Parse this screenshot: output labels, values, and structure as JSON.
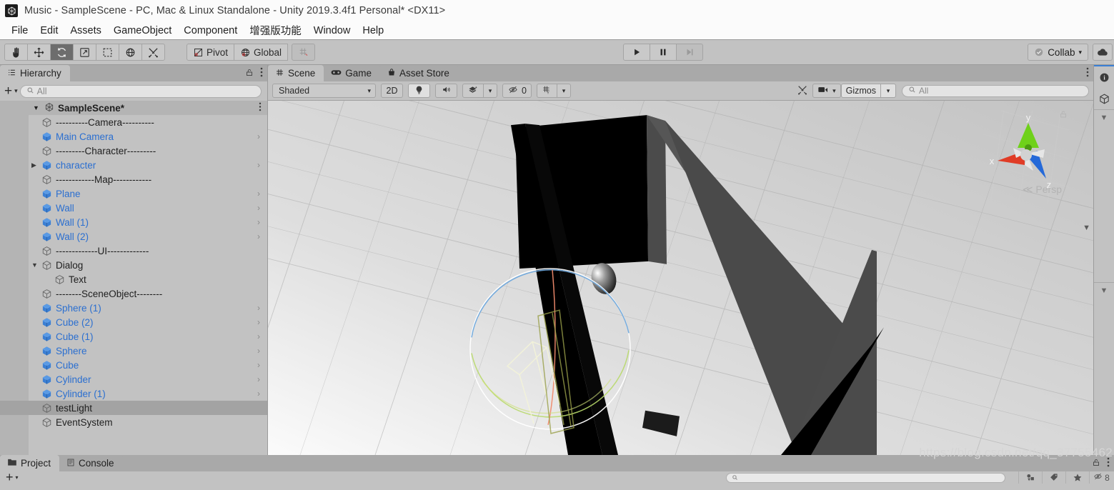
{
  "window": {
    "title": "Music - SampleScene - PC, Mac & Linux Standalone - Unity 2019.3.4f1 Personal* <DX11>",
    "logo_icon": "unity-logo-icon"
  },
  "menubar": {
    "items": [
      {
        "label": "File"
      },
      {
        "label": "Edit"
      },
      {
        "label": "Assets"
      },
      {
        "label": "GameObject"
      },
      {
        "label": "Component"
      },
      {
        "label": "增强版功能"
      },
      {
        "label": "Window"
      },
      {
        "label": "Help"
      }
    ]
  },
  "toolbar": {
    "tools": [
      {
        "name": "hand-tool",
        "icon": "hand-icon",
        "active": false
      },
      {
        "name": "move-tool",
        "icon": "move-arrows-icon",
        "active": false
      },
      {
        "name": "rotate-tool",
        "icon": "rotate-icon",
        "active": true
      },
      {
        "name": "scale-tool",
        "icon": "scale-icon",
        "active": false
      },
      {
        "name": "rect-tool",
        "icon": "rect-transform-icon",
        "active": false
      },
      {
        "name": "transform-tool",
        "icon": "transform-icon",
        "active": false
      },
      {
        "name": "custom-tool",
        "icon": "wrench-hammer-icon",
        "active": false
      }
    ],
    "pivot_label": "Pivot",
    "pivot_icon": "pivot-icon",
    "global_label": "Global",
    "global_icon": "globe-icon",
    "snap_icon": "grid-snap-icon",
    "play_label": "play-icon",
    "pause_label": "pause-icon",
    "step_label": "step-icon",
    "collab_label": "Collab",
    "collab_icon": "cloud-check-icon",
    "collab_caret": "▾",
    "cloud_icon": "cloud-icon"
  },
  "hierarchy": {
    "tabs": [
      {
        "label": "Hierarchy",
        "icon": "hierarchy-icon",
        "active": true
      }
    ],
    "lock_icon": "lock-open-icon",
    "kebab_icon": "kebab-menu-icon",
    "add_label": "+",
    "add_caret": "▾",
    "search": {
      "placeholder": "All",
      "value": "",
      "icon": "search-icon"
    },
    "scene_root": {
      "label": "SampleScene*",
      "icon": "unity-scene-icon",
      "expanded": true
    },
    "items": [
      {
        "label": "----------Camera----------",
        "kind": "separator",
        "icon": "cube-outline-icon",
        "selected": false,
        "expandable": false,
        "arrow": false
      },
      {
        "label": "Main Camera",
        "kind": "prefab",
        "icon": "cube-blue-icon",
        "selected": false,
        "expandable": false,
        "arrow": true
      },
      {
        "label": "---------Character---------",
        "kind": "separator",
        "icon": "cube-outline-icon",
        "selected": false,
        "expandable": false,
        "arrow": false
      },
      {
        "label": "character",
        "kind": "prefab",
        "icon": "cube-blue-icon",
        "selected": false,
        "expandable": true,
        "arrow": true
      },
      {
        "label": "------------Map------------",
        "kind": "separator",
        "icon": "cube-outline-icon",
        "selected": false,
        "expandable": false,
        "arrow": false
      },
      {
        "label": "Plane",
        "kind": "prefab",
        "icon": "cube-blue-icon",
        "selected": false,
        "expandable": false,
        "arrow": true
      },
      {
        "label": "Wall",
        "kind": "prefab",
        "icon": "cube-blue-icon",
        "selected": false,
        "expandable": false,
        "arrow": true
      },
      {
        "label": "Wall (1)",
        "kind": "prefab",
        "icon": "cube-blue-icon",
        "selected": false,
        "expandable": false,
        "arrow": true
      },
      {
        "label": "Wall (2)",
        "kind": "prefab",
        "icon": "cube-blue-icon",
        "selected": false,
        "expandable": false,
        "arrow": true
      },
      {
        "label": "-------------UI-------------",
        "kind": "separator",
        "icon": "cube-outline-icon",
        "selected": false,
        "expandable": false,
        "arrow": false
      },
      {
        "label": "Dialog",
        "kind": "object",
        "icon": "cube-outline-icon",
        "selected": false,
        "expandable": true,
        "expanded": true,
        "arrow": false
      },
      {
        "label": "Text",
        "kind": "object",
        "icon": "cube-outline-icon",
        "selected": false,
        "expandable": false,
        "arrow": false,
        "indent": 2
      },
      {
        "label": "--------SceneObject--------",
        "kind": "separator",
        "icon": "cube-outline-icon",
        "selected": false,
        "expandable": false,
        "arrow": false
      },
      {
        "label": "Sphere (1)",
        "kind": "prefab",
        "icon": "cube-blue-icon",
        "selected": false,
        "expandable": false,
        "arrow": true
      },
      {
        "label": "Cube (2)",
        "kind": "prefab",
        "icon": "cube-blue-icon",
        "selected": false,
        "expandable": false,
        "arrow": true
      },
      {
        "label": "Cube (1)",
        "kind": "prefab",
        "icon": "cube-blue-icon",
        "selected": false,
        "expandable": false,
        "arrow": true
      },
      {
        "label": "Sphere",
        "kind": "prefab",
        "icon": "cube-blue-icon",
        "selected": false,
        "expandable": false,
        "arrow": true
      },
      {
        "label": "Cube",
        "kind": "prefab",
        "icon": "cube-blue-icon",
        "selected": false,
        "expandable": false,
        "arrow": true
      },
      {
        "label": "Cylinder",
        "kind": "prefab",
        "icon": "cube-blue-icon",
        "selected": false,
        "expandable": false,
        "arrow": true
      },
      {
        "label": "Cylinder (1)",
        "kind": "prefab",
        "icon": "cube-blue-icon",
        "selected": false,
        "expandable": false,
        "arrow": true
      },
      {
        "label": "testLight",
        "kind": "object",
        "icon": "cube-outline-icon",
        "selected": true,
        "expandable": false,
        "arrow": false
      },
      {
        "label": "EventSystem",
        "kind": "object",
        "icon": "cube-outline-icon",
        "selected": false,
        "expandable": false,
        "arrow": false
      }
    ]
  },
  "scene_panel": {
    "tabs": [
      {
        "label": "Scene",
        "icon": "scene-grid-icon",
        "active": true
      },
      {
        "label": "Game",
        "icon": "gamepad-icon",
        "active": false
      },
      {
        "label": "Asset Store",
        "icon": "shop-bag-icon",
        "active": false
      }
    ],
    "kebab_icon": "kebab-menu-icon",
    "toolbar": {
      "draw_mode": "Shaded",
      "draw_mode_caret": "▾",
      "mode_2d": "2D",
      "lighting_icon": "lightbulb-icon",
      "audio_icon": "speaker-icon",
      "fx_icon": "fx-layers-icon",
      "fx_caret": "▾",
      "hidden_icon": "eye-off-icon",
      "hidden_count": "0",
      "grid_icon": "grid-y-icon",
      "grid_caret": "▾",
      "tools_icon": "wrench-hammer-icon",
      "camera_icon": "camera-icon",
      "camera_caret": "▾",
      "gizmos_label": "Gizmos",
      "gizmos_caret": "▾",
      "search": {
        "placeholder": "All",
        "value": "",
        "icon": "search-icon"
      }
    },
    "gizmo": {
      "axis_x": "x",
      "axis_y": "y",
      "axis_z": "z",
      "projection": "Persp",
      "projection_prefix": "≪",
      "color_x": "#e03c26",
      "color_y": "#6fd11a",
      "color_z": "#2569d8",
      "lock_icon": "lock-icon"
    }
  },
  "bottom_panel": {
    "tabs": [
      {
        "label": "Project",
        "icon": "folder-icon",
        "active": true
      },
      {
        "label": "Console",
        "icon": "console-icon",
        "active": false
      }
    ],
    "add_label": "+",
    "add_caret": "▾",
    "search": {
      "placeholder": "",
      "value": "",
      "icon": "search-icon"
    },
    "lock_icon": "lock-open-icon",
    "kebab_icon": "kebab-menu-icon",
    "status_icons": [
      {
        "name": "shapes-icon",
        "label": ""
      },
      {
        "name": "tag-icon",
        "label": ""
      },
      {
        "name": "star-icon",
        "label": ""
      },
      {
        "name": "eye-off-icon",
        "label": "8"
      }
    ]
  },
  "right_rail": {
    "items": [
      {
        "name": "info-icon"
      },
      {
        "name": "cube-icon"
      }
    ],
    "chevron": "▼"
  },
  "watermark": {
    "text": "https://blog.csdn.net/qq_37755462"
  },
  "colors": {
    "accent_blue": "#2b6fd0",
    "panel_bg": "#c2c2c2",
    "tab_bg": "#a9a9a9",
    "selected_row": "#a3a3a3",
    "scene_floor": "#c7c7c7",
    "scene_wall_dark": "#000000",
    "scene_wall_side": "#4b4b4b"
  }
}
